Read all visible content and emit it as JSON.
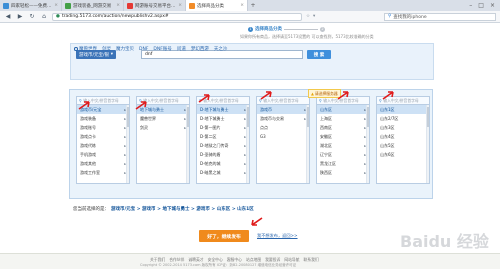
{
  "browser": {
    "tabs": [
      {
        "label": "四家轻松——免费注册网页",
        "active": false,
        "icon": "page-icon"
      },
      {
        "label": "游戏装备_网游交易",
        "active": false,
        "icon": "game-icon"
      },
      {
        "label": "网游账号交易平台游戏装备",
        "active": false,
        "icon": "game-icon"
      },
      {
        "label": "选择商品分类",
        "active": true,
        "icon": "page-icon"
      }
    ],
    "url": "trading.5173.com/auction/newpublishv2.aspx#",
    "search_text": "查找我的iphone",
    "window_controls": [
      "–",
      "□",
      "×"
    ]
  },
  "progress": {
    "steps": [
      {
        "num": "1",
        "label": "选择商品分类",
        "active": true
      },
      {
        "num": "2",
        "label": "",
        "active": false
      }
    ]
  },
  "helpline": "如果你所有商品，选择请至5173设置的 可以查找到，5173比较准确的分类",
  "form": {
    "category_select": "游戏币/元宝/银",
    "keyword_value": "dnf",
    "search_button": "搜 索",
    "hot_items": [
      "魔兽世界",
      "剑灵",
      "魔力宝贝",
      "DNF",
      "DNF账号",
      "问道",
      "梦幻西游",
      "天之沙"
    ]
  },
  "picker": {
    "search_placeholder": "输入中文/拼音首字母",
    "tip": "请选择服务器",
    "columns": [
      {
        "items": [
          {
            "label": "游戏币/元宝",
            "selected": true
          },
          {
            "label": "游戏装备",
            "selected": false
          },
          {
            "label": "游戏账号",
            "selected": false
          },
          {
            "label": "游戏点卡",
            "selected": false
          },
          {
            "label": "游戏代练",
            "selected": false
          },
          {
            "label": "手机游戏",
            "selected": false
          },
          {
            "label": "游戏其他",
            "selected": false
          },
          {
            "label": "游戏工作室",
            "selected": false
          }
        ]
      },
      {
        "items": [
          {
            "label": "地下城与勇士",
            "selected": true
          },
          {
            "label": "魔兽世界",
            "selected": false
          },
          {
            "label": "剑灵",
            "selected": false
          }
        ]
      },
      {
        "items": [
          {
            "label": "D-地下城与勇士",
            "selected": true
          },
          {
            "label": "D-地下城勇士",
            "selected": false
          },
          {
            "label": "D-第一图片",
            "selected": false
          },
          {
            "label": "D-第二区",
            "selected": false
          },
          {
            "label": "D-地狱之门传奇",
            "selected": false
          },
          {
            "label": "D-圣骑的盾",
            "selected": false
          },
          {
            "label": "D-帕克的城",
            "selected": false
          },
          {
            "label": "D-暗黑之城",
            "selected": false
          }
        ]
      },
      {
        "items": [
          {
            "label": "游戏币",
            "selected": true
          },
          {
            "label": "游戏币与交易",
            "selected": false
          },
          {
            "label": "点点",
            "selected": false
          },
          {
            "label": "G3",
            "selected": false
          }
        ]
      },
      {
        "items": [
          {
            "label": "山东区",
            "selected": true
          },
          {
            "label": "上海区",
            "selected": false
          },
          {
            "label": "西南区",
            "selected": false
          },
          {
            "label": "安徽区",
            "selected": false
          },
          {
            "label": "湖北区",
            "selected": false
          },
          {
            "label": "辽宁区",
            "selected": false
          },
          {
            "label": "黑龙江区",
            "selected": false
          },
          {
            "label": "陕西区",
            "selected": false
          }
        ]
      },
      {
        "items": [
          {
            "label": "山东1区",
            "selected": true
          },
          {
            "label": "山东2/7区",
            "selected": false
          },
          {
            "label": "山东3区",
            "selected": false
          },
          {
            "label": "山东4区",
            "selected": false
          },
          {
            "label": "山东5区",
            "selected": false
          },
          {
            "label": "山东6区",
            "selected": false
          }
        ]
      }
    ]
  },
  "chosen": {
    "label": "您当前选择的是：",
    "value": "游戏币/元宝 > 游戏币 > 地下城与勇士 > 游戏币 > 山东区 > 山东1区"
  },
  "publish_button": "好了，继续发布",
  "back_link": "我不想发布，返回>>",
  "footer": {
    "links": [
      "关于我们",
      "合作伙伴",
      "诚聘英才",
      "安全中心",
      "客服中心",
      "站点地图",
      "我要投诉",
      "网站导航",
      "联系我们"
    ],
    "copyright": "Copyright © 2002-2014 5173.com 版权所有  ICP证：浙B2-20080127  增值电信业务经营许可证"
  },
  "watermark": "Baidu 经验",
  "colors": {
    "accent_blue": "#3a73b8",
    "publish_orange": "#f08a1c",
    "annotation_red": "#e01b1b"
  }
}
